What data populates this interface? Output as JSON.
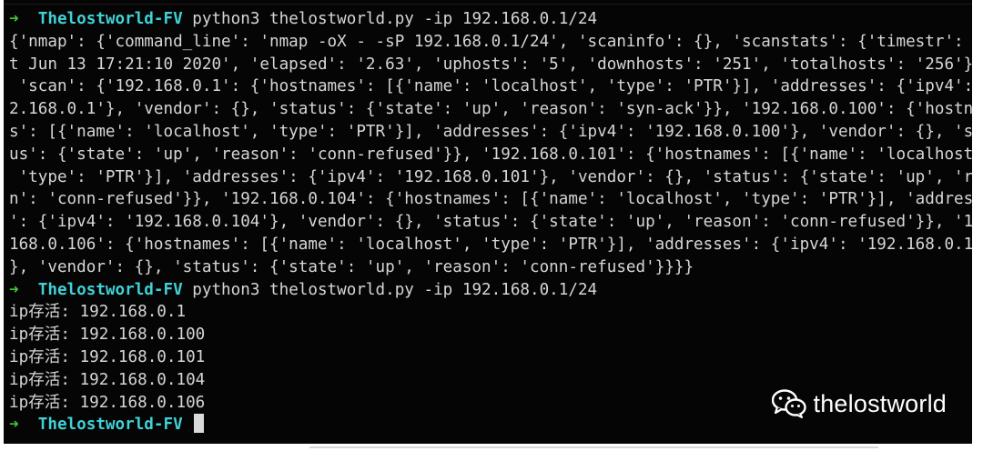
{
  "terminal": {
    "prompt": {
      "arrow": "➜",
      "directory": "Thelostworld-FV"
    },
    "command_1": "python3 thelostworld.py -ip 192.168.0.1/24",
    "output_1": [
      "{'nmap': {'command_line': 'nmap -oX - -sP 192.168.0.1/24', 'scaninfo': {}, 'scanstats': {'timestr': 'Sa",
      "t Jun 13 17:21:10 2020', 'elapsed': '2.63', 'uphosts': '5', 'downhosts': '251', 'totalhosts': '256'}},",
      " 'scan': {'192.168.0.1': {'hostnames': [{'name': 'localhost', 'type': 'PTR'}], 'addresses': {'ipv4': '19",
      "2.168.0.1'}, 'vendor': {}, 'status': {'state': 'up', 'reason': 'syn-ack'}}, '192.168.0.100': {'hostname",
      "s': [{'name': 'localhost', 'type': 'PTR'}], 'addresses': {'ipv4': '192.168.0.100'}, 'vendor': {}, 'stat",
      "us': {'state': 'up', 'reason': 'conn-refused'}}, '192.168.0.101': {'hostnames': [{'name': 'localhost',",
      " 'type': 'PTR'}], 'addresses': {'ipv4': '192.168.0.101'}, 'vendor': {}, 'status': {'state': 'up', 'reaso",
      "n': 'conn-refused'}}, '192.168.0.104': {'hostnames': [{'name': 'localhost', 'type': 'PTR'}], 'addresses",
      "': {'ipv4': '192.168.0.104'}, 'vendor': {}, 'status': {'state': 'up', 'reason': 'conn-refused'}}, '192.",
      "168.0.106': {'hostnames': [{'name': 'localhost', 'type': 'PTR'}], 'addresses': {'ipv4': '192.168.0.106'",
      "}, 'vendor': {}, 'status': {'state': 'up', 'reason': 'conn-refused'}}}}"
    ],
    "command_2": "python3 thelostworld.py -ip 192.168.0.1/24",
    "output_2": [
      "ip存活: 192.168.0.1",
      "ip存活: 192.168.0.100",
      "ip存活: 192.168.0.101",
      "ip存活: 192.168.0.104",
      "ip存活: 192.168.0.106"
    ]
  },
  "watermark": {
    "text": "thelostworld",
    "icon": "wechat-icon"
  },
  "colors": {
    "background": "#050505",
    "text": "#d6d6d6",
    "prompt_arrow": "#3fc93a",
    "prompt_directory": "#3fd2d6"
  }
}
